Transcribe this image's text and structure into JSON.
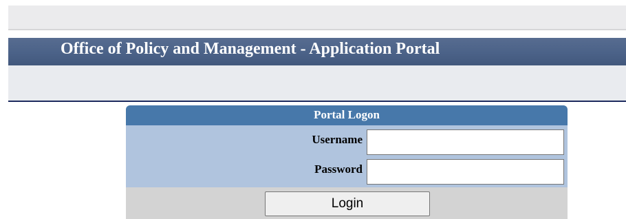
{
  "header": {
    "title": "Office of Policy and Management - Application Portal"
  },
  "logon": {
    "heading": "Portal Logon",
    "username_label": "Username",
    "username_value": "",
    "password_label": "Password",
    "password_value": "",
    "login_label": "Login"
  },
  "colors": {
    "title_bar": "#4b6288",
    "logon_header": "#4778aa",
    "logon_body": "#b0c4de",
    "logon_footer": "#d3d3d3",
    "divider": "#1c2a5e"
  }
}
